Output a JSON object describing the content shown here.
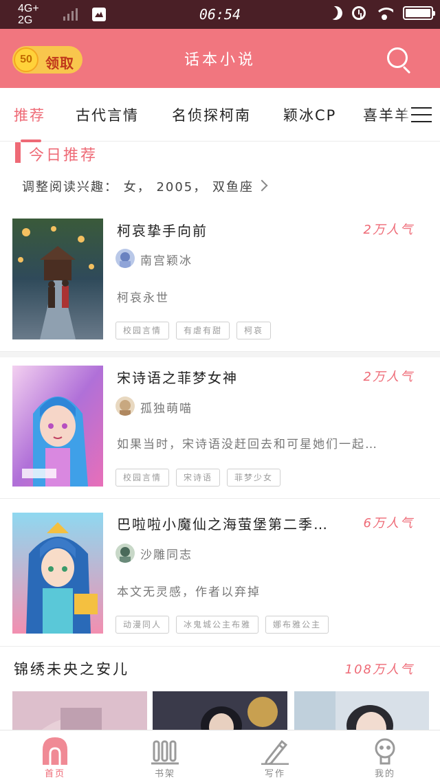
{
  "status_bar": {
    "network_top": "4G+",
    "network_bottom": "2G",
    "time": "06:54"
  },
  "header": {
    "coin_amount": "50",
    "claim_label": "领取",
    "title": "话本小说",
    "search_icon": "search-icon"
  },
  "tabs": [
    {
      "label": "推荐",
      "active": true
    },
    {
      "label": "古代言情"
    },
    {
      "label": "名侦探柯南"
    },
    {
      "label": "颖冰CP"
    },
    {
      "label": "喜羊羊"
    }
  ],
  "today": {
    "title": "今日推荐",
    "interest": "调整阅读兴趣： 女， 2005， 双鱼座"
  },
  "books": [
    {
      "title": "柯哀挚手向前",
      "popularity": "2万人气",
      "author": "南宫颖冰",
      "description": "柯哀永世",
      "tags": [
        "校园言情",
        "有虐有甜",
        "柯哀"
      ]
    },
    {
      "title": "宋诗语之菲梦女神",
      "popularity": "2万人气",
      "author": "孤独萌喵",
      "description": "如果当时，宋诗语没赶回去和可星她们一起…",
      "tags": [
        "校园言情",
        "宋诗语",
        "菲梦少女"
      ]
    },
    {
      "title": "巴啦啦小魔仙之海萤堡第二季…",
      "popularity": "6万人气",
      "author": "沙雕同志",
      "description": "本文无灵感，作者以弃掉",
      "tags": [
        "动漫同人",
        "冰鬼城公主布雅",
        "娜布雅公主"
      ]
    }
  ],
  "featured": {
    "title": "锦绣未央之安儿",
    "popularity": "108万人气"
  },
  "bottom_nav": [
    {
      "label": "首页",
      "icon": "home-icon",
      "active": true
    },
    {
      "label": "书架",
      "icon": "bookshelf-icon"
    },
    {
      "label": "写作",
      "icon": "pen-icon"
    },
    {
      "label": "我的",
      "icon": "profile-icon"
    }
  ],
  "colors": {
    "accent": "#ee6a76",
    "header": "#f1767f",
    "status_bar": "#4a1f26"
  }
}
